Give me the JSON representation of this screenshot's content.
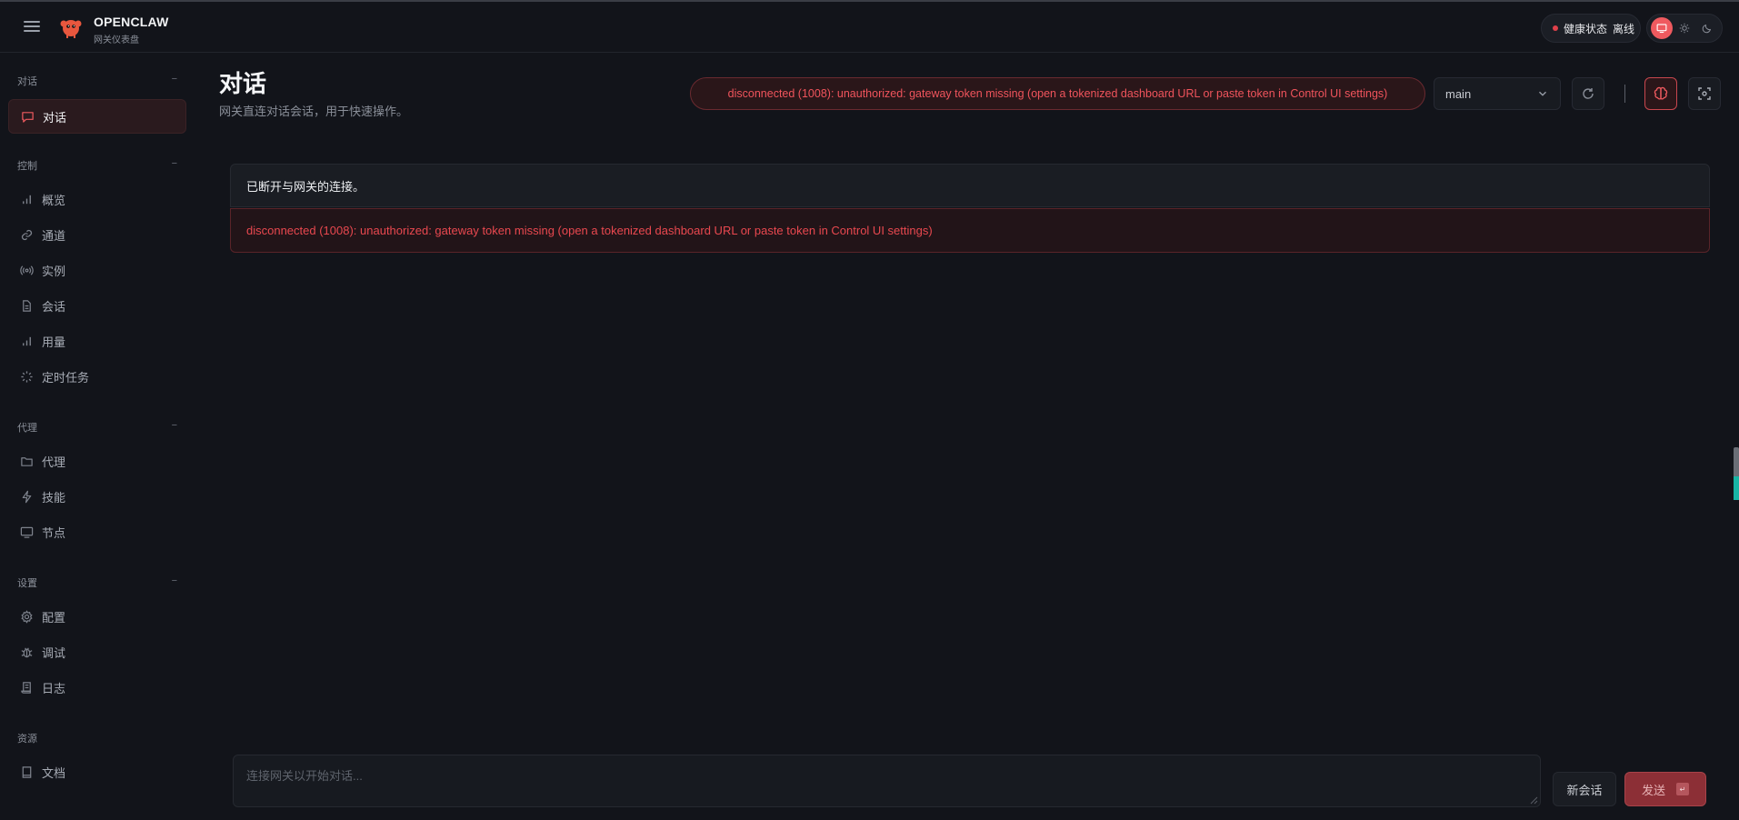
{
  "header": {
    "brand_title": "OPENCLAW",
    "brand_sub": "网关仪表盘",
    "health_label": "健康状态",
    "health_status": "离线",
    "theme_icons": [
      "monitor-icon",
      "sun-icon",
      "moon-icon"
    ],
    "accent_color": "#ef5a5f"
  },
  "sidebar": {
    "sections": [
      {
        "title": "对话",
        "collapse": "−",
        "items": [
          {
            "label": "对话",
            "icon": "chat-icon",
            "active": true
          }
        ]
      },
      {
        "title": "控制",
        "collapse": "−",
        "items": [
          {
            "label": "概览",
            "icon": "bar-chart-icon"
          },
          {
            "label": "通道",
            "icon": "link-icon"
          },
          {
            "label": "实例",
            "icon": "broadcast-icon"
          },
          {
            "label": "会话",
            "icon": "document-icon"
          },
          {
            "label": "用量",
            "icon": "bar-chart-icon"
          },
          {
            "label": "定时任务",
            "icon": "loader-icon"
          }
        ]
      },
      {
        "title": "代理",
        "collapse": "−",
        "items": [
          {
            "label": "代理",
            "icon": "folder-icon"
          },
          {
            "label": "技能",
            "icon": "lightning-icon"
          },
          {
            "label": "节点",
            "icon": "monitor-icon"
          }
        ]
      },
      {
        "title": "设置",
        "collapse": "−",
        "items": [
          {
            "label": "配置",
            "icon": "gear-icon"
          },
          {
            "label": "调试",
            "icon": "bug-icon"
          },
          {
            "label": "日志",
            "icon": "scroll-icon"
          }
        ]
      },
      {
        "title": "资源",
        "items": [
          {
            "label": "文档",
            "icon": "book-icon"
          }
        ]
      }
    ]
  },
  "main": {
    "title": "对话",
    "subtitle": "网关直连对话会话，用于快速操作。",
    "error_pill": "disconnected (1008): unauthorized: gateway token missing (open a tokenized dashboard URL or paste token in Control UI settings)",
    "session_value": "main",
    "banner_text": "已断开与网关的连接。",
    "banner_error": "disconnected (1008): unauthorized: gateway token missing (open a tokenized dashboard URL or paste token in Control UI settings)",
    "composer_placeholder": "连接网关以开始对话...",
    "new_session_label": "新会话",
    "send_label": "发送",
    "send_kbd": "↵"
  }
}
